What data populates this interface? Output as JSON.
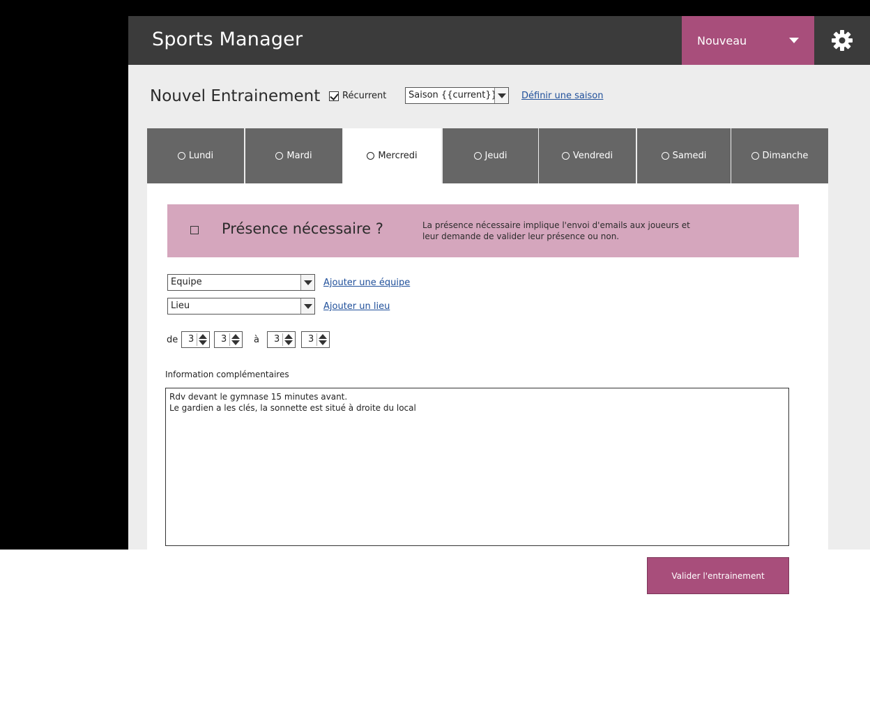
{
  "header": {
    "app_title": "Sports Manager",
    "new_button_label": "Nouveau",
    "settings_icon": "gear-icon"
  },
  "form": {
    "title": "Nouvel Entrainement",
    "recurrent_label": "Récurrent",
    "recurrent_checked": true,
    "season_select_value": "Saison {{current}}",
    "define_season_link": "Définir une saison"
  },
  "days": [
    {
      "label": "Lundi",
      "active": false
    },
    {
      "label": "Mardi",
      "active": false
    },
    {
      "label": "Mercredi",
      "active": true
    },
    {
      "label": "Jeudi",
      "active": false
    },
    {
      "label": "Vendredi",
      "active": false
    },
    {
      "label": "Samedi",
      "active": false
    },
    {
      "label": "Dimanche",
      "active": false
    }
  ],
  "presence": {
    "question": "Présence nécessaire ?",
    "checked": false,
    "description": "La présence nécessaire implique l'envoi d'emails aux joueurs et leur demande de valider leur présence ou non."
  },
  "team": {
    "select_value": "Equipe",
    "add_link": "Ajouter une équipe"
  },
  "place": {
    "select_value": "Lieu",
    "add_link": "Ajouter un lieu"
  },
  "time": {
    "from_label": "de",
    "to_label": "à",
    "from_hour": "3",
    "from_minute": "3",
    "to_hour": "3",
    "to_minute": "3"
  },
  "info": {
    "label": "Information complémentaires",
    "text": "Rdv devant le gymnase 15 minutes avant.\nLe gardien a les clés, la sonnette est situé à droite du local"
  },
  "submit_label": "Valider l'entrainement",
  "colors": {
    "accent": "#a84e7b",
    "banner": "#d5a6bd",
    "header": "#3b3b3b",
    "tab_inactive": "#666666"
  }
}
